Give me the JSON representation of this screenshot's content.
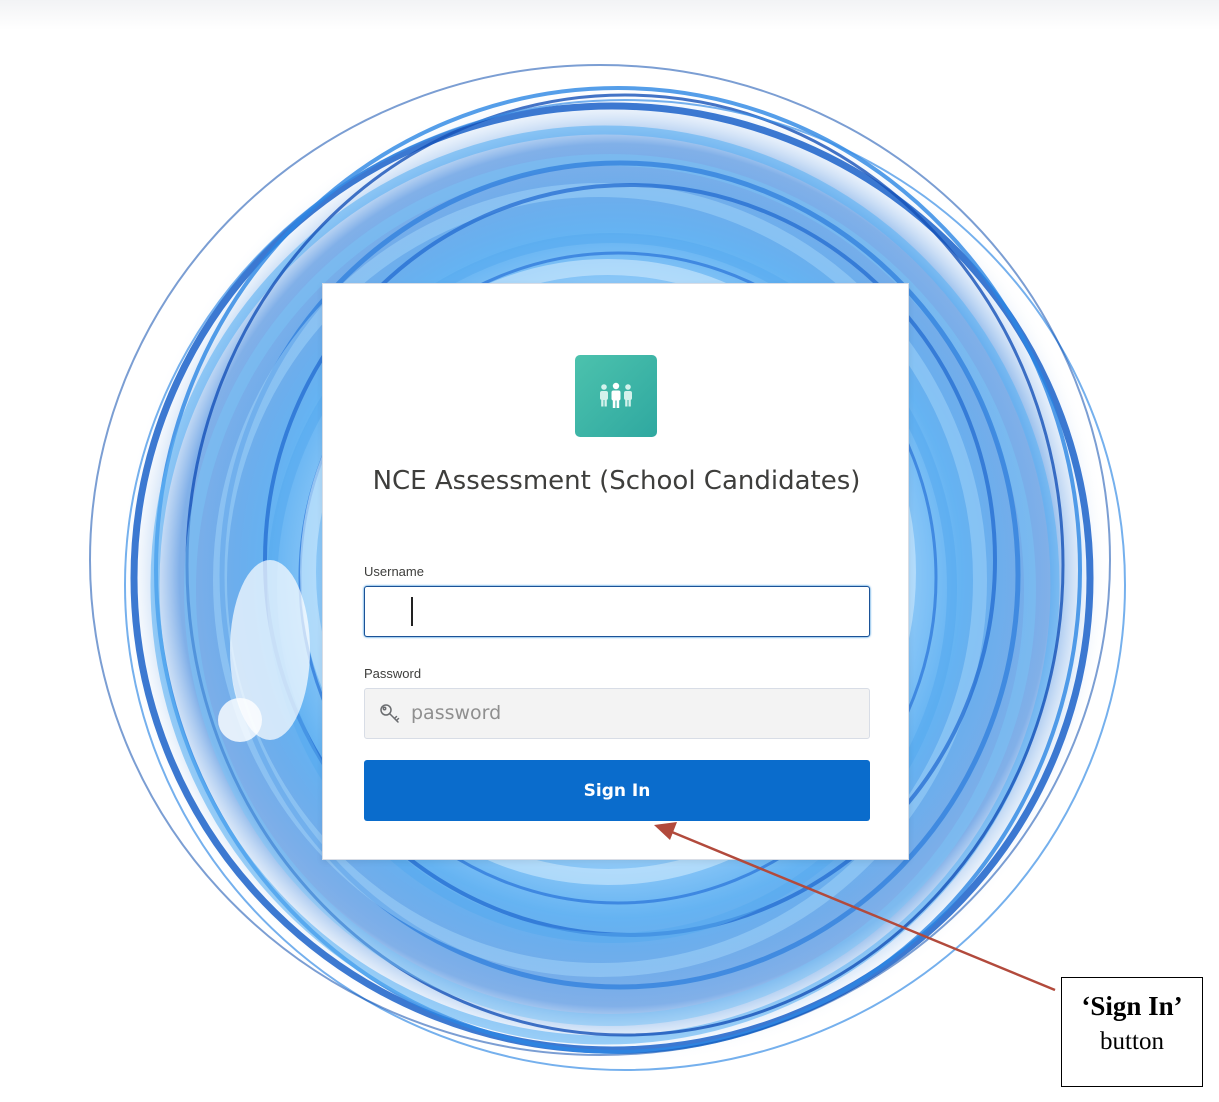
{
  "app": {
    "title": "NCE Assessment (School Candidates)",
    "logo_icon": "group-people-icon",
    "accent_color": "#3bb7a6"
  },
  "login_form": {
    "username_label": "Username",
    "username_value": "",
    "password_label": "Password",
    "password_placeholder": "password",
    "password_icon": "key-icon",
    "sign_in_label": "Sign In",
    "button_color": "#0a6ccc"
  },
  "annotation": {
    "callout_title": "‘Sign In’",
    "callout_subtitle": "button",
    "arrow_color": "#b24a3c"
  }
}
